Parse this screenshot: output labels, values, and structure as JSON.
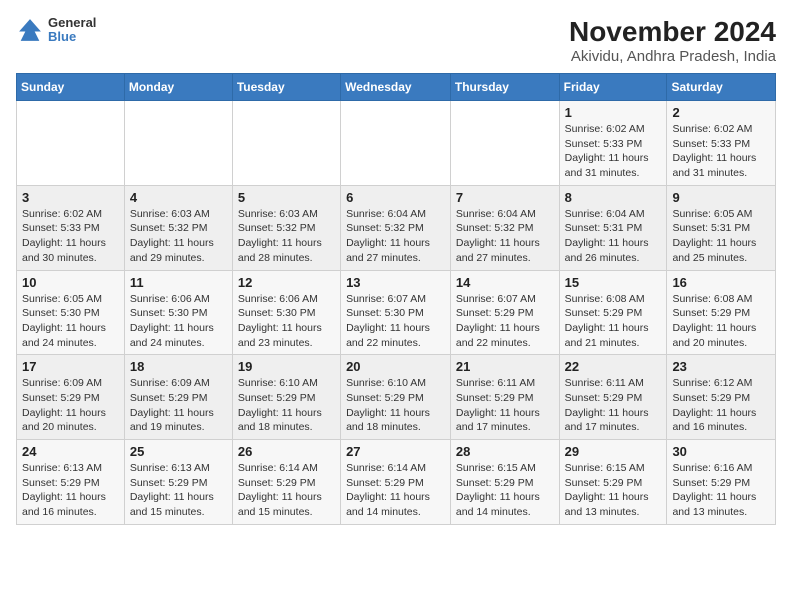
{
  "header": {
    "logo_line1": "General",
    "logo_line2": "Blue",
    "title": "November 2024",
    "subtitle": "Akividu, Andhra Pradesh, India"
  },
  "weekdays": [
    "Sunday",
    "Monday",
    "Tuesday",
    "Wednesday",
    "Thursday",
    "Friday",
    "Saturday"
  ],
  "weeks": [
    [
      {
        "day": "",
        "info": ""
      },
      {
        "day": "",
        "info": ""
      },
      {
        "day": "",
        "info": ""
      },
      {
        "day": "",
        "info": ""
      },
      {
        "day": "",
        "info": ""
      },
      {
        "day": "1",
        "info": "Sunrise: 6:02 AM\nSunset: 5:33 PM\nDaylight: 11 hours and 31 minutes."
      },
      {
        "day": "2",
        "info": "Sunrise: 6:02 AM\nSunset: 5:33 PM\nDaylight: 11 hours and 31 minutes."
      }
    ],
    [
      {
        "day": "3",
        "info": "Sunrise: 6:02 AM\nSunset: 5:33 PM\nDaylight: 11 hours and 30 minutes."
      },
      {
        "day": "4",
        "info": "Sunrise: 6:03 AM\nSunset: 5:32 PM\nDaylight: 11 hours and 29 minutes."
      },
      {
        "day": "5",
        "info": "Sunrise: 6:03 AM\nSunset: 5:32 PM\nDaylight: 11 hours and 28 minutes."
      },
      {
        "day": "6",
        "info": "Sunrise: 6:04 AM\nSunset: 5:32 PM\nDaylight: 11 hours and 27 minutes."
      },
      {
        "day": "7",
        "info": "Sunrise: 6:04 AM\nSunset: 5:32 PM\nDaylight: 11 hours and 27 minutes."
      },
      {
        "day": "8",
        "info": "Sunrise: 6:04 AM\nSunset: 5:31 PM\nDaylight: 11 hours and 26 minutes."
      },
      {
        "day": "9",
        "info": "Sunrise: 6:05 AM\nSunset: 5:31 PM\nDaylight: 11 hours and 25 minutes."
      }
    ],
    [
      {
        "day": "10",
        "info": "Sunrise: 6:05 AM\nSunset: 5:30 PM\nDaylight: 11 hours and 24 minutes."
      },
      {
        "day": "11",
        "info": "Sunrise: 6:06 AM\nSunset: 5:30 PM\nDaylight: 11 hours and 24 minutes."
      },
      {
        "day": "12",
        "info": "Sunrise: 6:06 AM\nSunset: 5:30 PM\nDaylight: 11 hours and 23 minutes."
      },
      {
        "day": "13",
        "info": "Sunrise: 6:07 AM\nSunset: 5:30 PM\nDaylight: 11 hours and 22 minutes."
      },
      {
        "day": "14",
        "info": "Sunrise: 6:07 AM\nSunset: 5:29 PM\nDaylight: 11 hours and 22 minutes."
      },
      {
        "day": "15",
        "info": "Sunrise: 6:08 AM\nSunset: 5:29 PM\nDaylight: 11 hours and 21 minutes."
      },
      {
        "day": "16",
        "info": "Sunrise: 6:08 AM\nSunset: 5:29 PM\nDaylight: 11 hours and 20 minutes."
      }
    ],
    [
      {
        "day": "17",
        "info": "Sunrise: 6:09 AM\nSunset: 5:29 PM\nDaylight: 11 hours and 20 minutes."
      },
      {
        "day": "18",
        "info": "Sunrise: 6:09 AM\nSunset: 5:29 PM\nDaylight: 11 hours and 19 minutes."
      },
      {
        "day": "19",
        "info": "Sunrise: 6:10 AM\nSunset: 5:29 PM\nDaylight: 11 hours and 18 minutes."
      },
      {
        "day": "20",
        "info": "Sunrise: 6:10 AM\nSunset: 5:29 PM\nDaylight: 11 hours and 18 minutes."
      },
      {
        "day": "21",
        "info": "Sunrise: 6:11 AM\nSunset: 5:29 PM\nDaylight: 11 hours and 17 minutes."
      },
      {
        "day": "22",
        "info": "Sunrise: 6:11 AM\nSunset: 5:29 PM\nDaylight: 11 hours and 17 minutes."
      },
      {
        "day": "23",
        "info": "Sunrise: 6:12 AM\nSunset: 5:29 PM\nDaylight: 11 hours and 16 minutes."
      }
    ],
    [
      {
        "day": "24",
        "info": "Sunrise: 6:13 AM\nSunset: 5:29 PM\nDaylight: 11 hours and 16 minutes."
      },
      {
        "day": "25",
        "info": "Sunrise: 6:13 AM\nSunset: 5:29 PM\nDaylight: 11 hours and 15 minutes."
      },
      {
        "day": "26",
        "info": "Sunrise: 6:14 AM\nSunset: 5:29 PM\nDaylight: 11 hours and 15 minutes."
      },
      {
        "day": "27",
        "info": "Sunrise: 6:14 AM\nSunset: 5:29 PM\nDaylight: 11 hours and 14 minutes."
      },
      {
        "day": "28",
        "info": "Sunrise: 6:15 AM\nSunset: 5:29 PM\nDaylight: 11 hours and 14 minutes."
      },
      {
        "day": "29",
        "info": "Sunrise: 6:15 AM\nSunset: 5:29 PM\nDaylight: 11 hours and 13 minutes."
      },
      {
        "day": "30",
        "info": "Sunrise: 6:16 AM\nSunset: 5:29 PM\nDaylight: 11 hours and 13 minutes."
      }
    ]
  ]
}
